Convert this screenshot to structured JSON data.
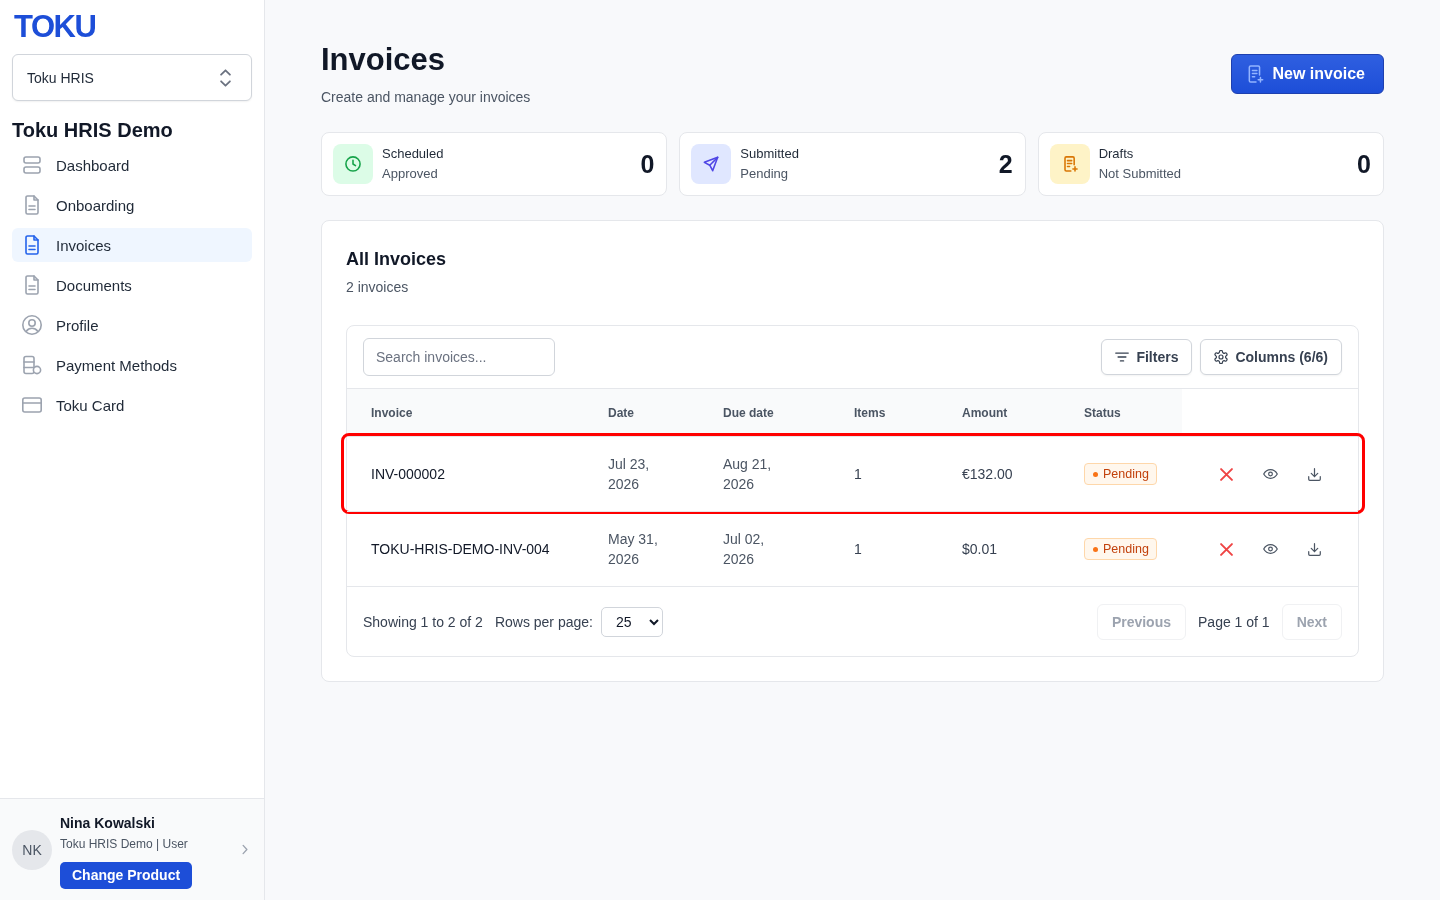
{
  "sidebar": {
    "logo": "TOKU",
    "product_selector": {
      "value": "Toku HRIS"
    },
    "workspace": "Toku HRIS Demo",
    "items": [
      {
        "label": "Dashboard",
        "kind": "dashboard",
        "selected": false
      },
      {
        "label": "Onboarding",
        "kind": "document",
        "selected": false
      },
      {
        "label": "Invoices",
        "kind": "document",
        "selected": true
      },
      {
        "label": "Documents",
        "kind": "document",
        "selected": false
      },
      {
        "label": "Profile",
        "kind": "profile",
        "selected": false
      },
      {
        "label": "Payment Methods",
        "kind": "payment",
        "selected": false
      },
      {
        "label": "Toku Card",
        "kind": "card",
        "selected": false
      }
    ],
    "user": {
      "initials": "NK",
      "name": "Nina Kowalski",
      "subtitle": "Toku HRIS Demo | User",
      "button": "Change Product"
    }
  },
  "header": {
    "title": "Invoices",
    "subtitle": "Create and manage your invoices",
    "new_button": "New invoice"
  },
  "stats": [
    {
      "kind": "scheduled",
      "label": "Scheduled",
      "sublabel": "Approved",
      "value": "0"
    },
    {
      "kind": "submitted",
      "label": "Submitted",
      "sublabel": "Pending",
      "value": "2"
    },
    {
      "kind": "draft",
      "label": "Drafts",
      "sublabel": "Not Submitted",
      "value": "0"
    }
  ],
  "invoices_panel": {
    "title": "All Invoices",
    "count": "2 invoices",
    "search": {
      "placeholder": "Search invoices..."
    },
    "filters_button": "Filters",
    "columns_button": "Columns (6/6)",
    "table": {
      "columns": [
        "Invoice",
        "Date",
        "Due date",
        "Items",
        "Amount",
        "Status"
      ],
      "rows": [
        {
          "invoice": "INV-000002",
          "date": "Jul 23, 2026",
          "due_date": "Aug 21, 2026",
          "items": "1",
          "amount": "€132.00",
          "status": {
            "label": "Pending",
            "kind": "pending"
          },
          "highlighted": true
        },
        {
          "invoice": "TOKU-HRIS-DEMO-INV-004",
          "date": "May 31, 2026",
          "due_date": "Jul 02, 2026",
          "items": "1",
          "amount": "$0.01",
          "status": {
            "label": "Pending",
            "kind": "pending"
          },
          "highlighted": false
        }
      ]
    },
    "footer": {
      "showing": "Showing 1 to 2 of 2",
      "rows_per_page_label": "Rows per page:",
      "rows_per_page": "25",
      "previous": {
        "label": "Previous",
        "disabled": true
      },
      "page_info": "Page 1 of 1",
      "next": {
        "label": "Next",
        "disabled": true
      }
    }
  }
}
